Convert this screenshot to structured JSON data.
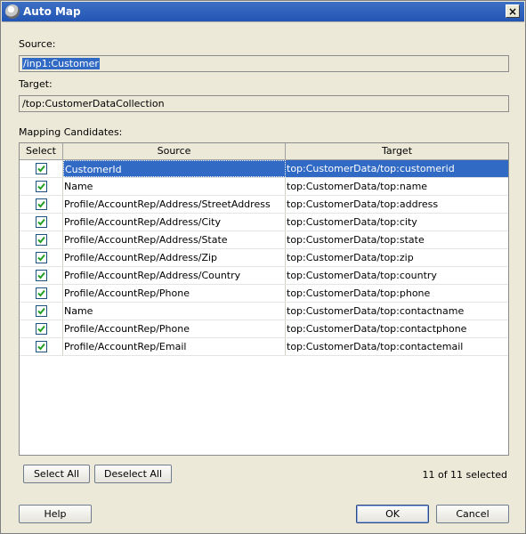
{
  "window": {
    "title": "Auto Map",
    "close_glyph": "×"
  },
  "source": {
    "label": "Source:",
    "value": "/inp1:Customer"
  },
  "target": {
    "label": "Target:",
    "value": "/top:CustomerDataCollection"
  },
  "mapping": {
    "label": "Mapping Candidates:"
  },
  "table": {
    "headers": {
      "select": "Select",
      "source": "Source",
      "target": "Target"
    },
    "rows": [
      {
        "checked": true,
        "source": "CustomerId",
        "target": "top:CustomerData/top:customerid"
      },
      {
        "checked": true,
        "source": "Name",
        "target": "top:CustomerData/top:name"
      },
      {
        "checked": true,
        "source": "Profile/AccountRep/Address/StreetAddress",
        "target": "top:CustomerData/top:address"
      },
      {
        "checked": true,
        "source": "Profile/AccountRep/Address/City",
        "target": "top:CustomerData/top:city"
      },
      {
        "checked": true,
        "source": "Profile/AccountRep/Address/State",
        "target": "top:CustomerData/top:state"
      },
      {
        "checked": true,
        "source": "Profile/AccountRep/Address/Zip",
        "target": "top:CustomerData/top:zip"
      },
      {
        "checked": true,
        "source": "Profile/AccountRep/Address/Country",
        "target": "top:CustomerData/top:country"
      },
      {
        "checked": true,
        "source": "Profile/AccountRep/Phone",
        "target": "top:CustomerData/top:phone"
      },
      {
        "checked": true,
        "source": "Name",
        "target": "top:CustomerData/top:contactname"
      },
      {
        "checked": true,
        "source": "Profile/AccountRep/Phone",
        "target": "top:CustomerData/top:contactphone"
      },
      {
        "checked": true,
        "source": "Profile/AccountRep/Email",
        "target": "top:CustomerData/top:contactemail"
      }
    ]
  },
  "buttons": {
    "select_all": "Select All",
    "deselect_all": "Deselect All",
    "help": "Help",
    "ok": "OK",
    "cancel": "Cancel"
  },
  "status": "11 of 11 selected",
  "colors": {
    "titlebar": "#2356b4",
    "selection": "#316ac5",
    "dialog_bg": "#ece9d8"
  }
}
